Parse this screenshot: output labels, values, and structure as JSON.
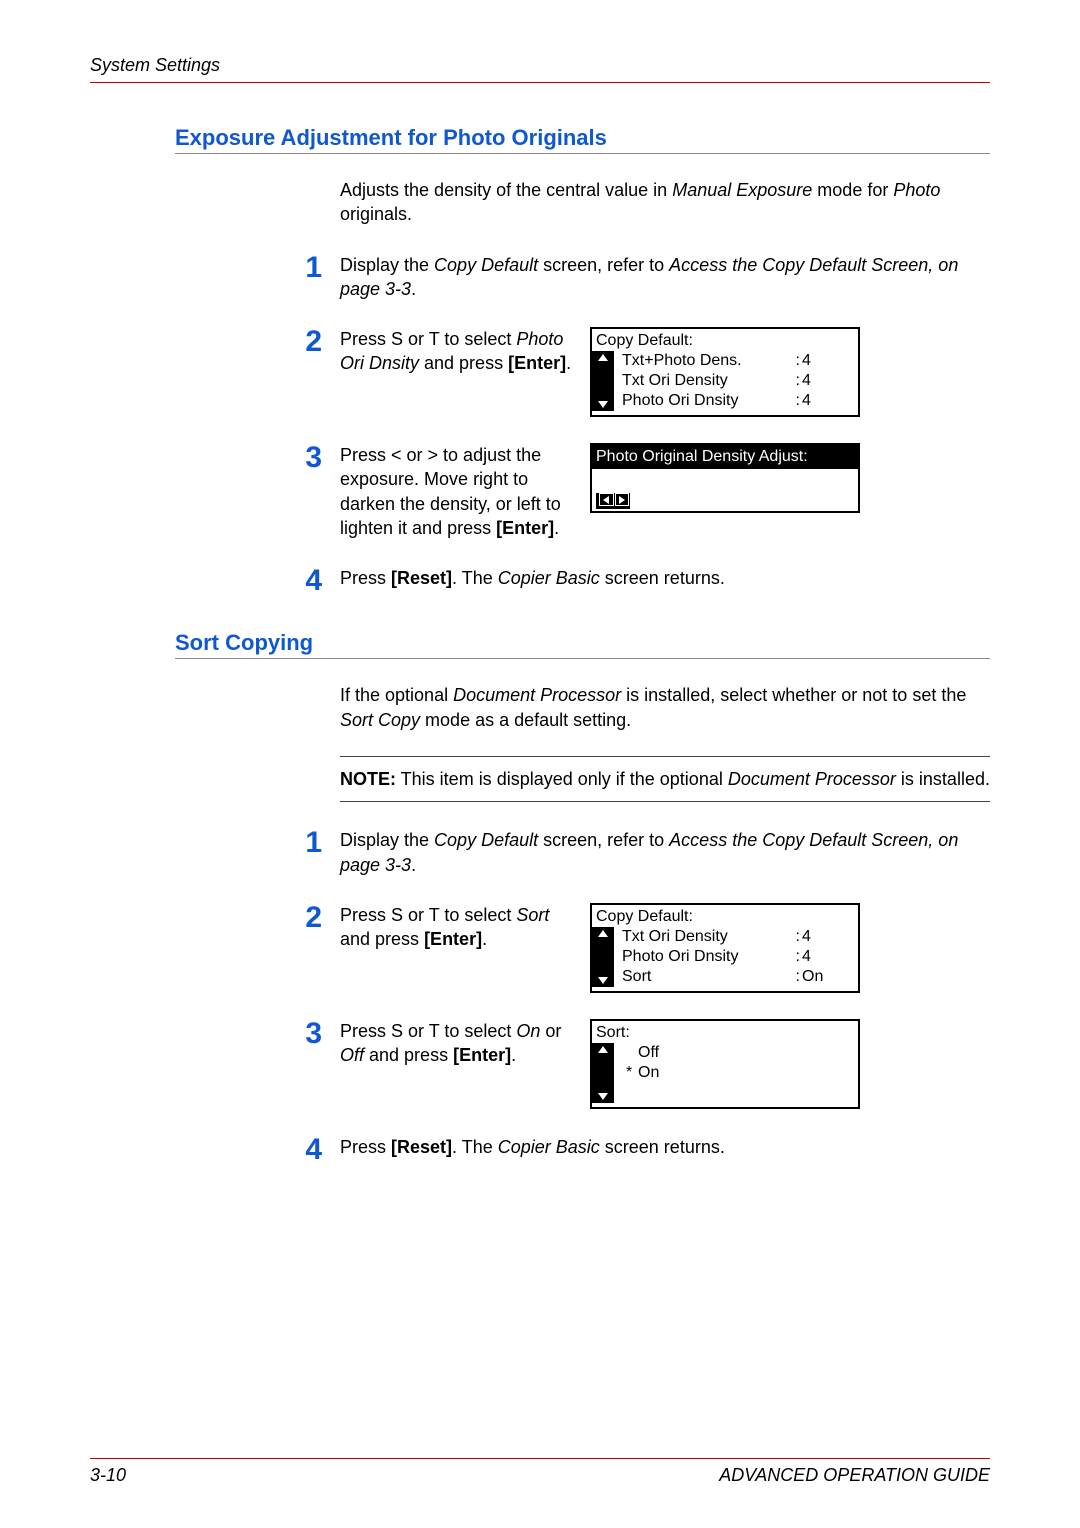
{
  "header": {
    "left": "System Settings",
    "right": ""
  },
  "footer": {
    "left": "3-10",
    "right": "ADVANCED OPERATION GUIDE"
  },
  "section1": {
    "heading": "Exposure Adjustment for Photo Originals",
    "intro_pre": "Adjusts the density of the central value in ",
    "intro_em1": "Manual Exposure",
    "intro_mid": " mode for ",
    "intro_em2": "Photo",
    "intro_post": " originals.",
    "steps": {
      "s1": {
        "num": "1",
        "t1": "Display the ",
        "em1": "Copy Default",
        "t2": " screen, refer to ",
        "em2": "Access the Copy Default Screen, on page 3-3",
        "t3": "."
      },
      "s2": {
        "num": "2",
        "t1": "Press  S or  T to select ",
        "em1": "Photo Ori Dnsity",
        "t2": " and press ",
        "b1": "[Enter]",
        "t3": ".",
        "lcd": {
          "title": "Copy Default:",
          "rows": [
            {
              "label": "Txt+Photo Dens.",
              "val": "4"
            },
            {
              "label": "Txt Ori Density",
              "val": "4"
            },
            {
              "label": "Photo Ori Dnsity",
              "val": "4"
            }
          ]
        }
      },
      "s3": {
        "num": "3",
        "t1": "Press < or > to adjust the exposure. Move right to darken the density, or left to lighten it and press ",
        "b1": "[Enter]",
        "t2": ".",
        "lcd_title": "Photo Original Density Adjust:"
      },
      "s4": {
        "num": "4",
        "t1": "Press ",
        "b1": "[Reset]",
        "t2": ". The ",
        "em1": "Copier Basic",
        "t3": " screen returns."
      }
    }
  },
  "section2": {
    "heading": "Sort Copying",
    "intro_pre": "If the optional ",
    "intro_em1": "Document Processor",
    "intro_mid": " is installed, select whether or not to set the ",
    "intro_em2": "Sort Copy",
    "intro_post": " mode as a default setting.",
    "note_b": "NOTE:",
    "note_t1": " This item is displayed only if the optional ",
    "note_em": "Document Processor",
    "note_t2": " is installed.",
    "steps": {
      "s1": {
        "num": "1",
        "t1": "Display the ",
        "em1": "Copy Default",
        "t2": " screen, refer to ",
        "em2": "Access the Copy Default Screen, on page 3-3",
        "t3": "."
      },
      "s2": {
        "num": "2",
        "t1": "Press  S or  T to select ",
        "em1": "Sort",
        "t2": " and press ",
        "b1": "[Enter]",
        "t3": ".",
        "lcd": {
          "title": "Copy Default:",
          "rows": [
            {
              "label": "Txt Ori Density",
              "val": "4"
            },
            {
              "label": "Photo Ori Dnsity",
              "val": "4"
            },
            {
              "label": "Sort",
              "val": "On"
            }
          ]
        }
      },
      "s3": {
        "num": "3",
        "t1": "Press  S or  T to select ",
        "em1": "On",
        "t2": " or ",
        "em2": "Off",
        "t3": " and press ",
        "b1": "[Enter]",
        "t4": ".",
        "lcd": {
          "title": "Sort:",
          "opts": [
            {
              "mark": "",
              "label": "Off"
            },
            {
              "mark": "*",
              "label": "On"
            }
          ]
        }
      },
      "s4": {
        "num": "4",
        "t1": "Press ",
        "b1": "[Reset]",
        "t2": ". The ",
        "em1": "Copier Basic",
        "t3": " screen returns."
      }
    }
  }
}
